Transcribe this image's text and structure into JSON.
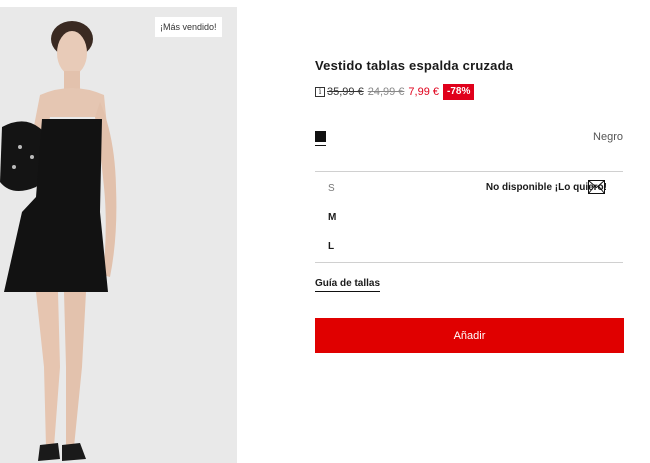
{
  "badge": "¡Más vendido!",
  "product": {
    "title": "Vestido tablas espalda cruzada",
    "info_icon": "i",
    "price_original": "35,99 €",
    "price_previous": "24,99 €",
    "price_current": "7,99 €",
    "discount": "-78%"
  },
  "color": {
    "name": "Negro",
    "swatch": "#111111"
  },
  "sizes": [
    {
      "label": "S",
      "available": false
    },
    {
      "label": "M",
      "available": true
    },
    {
      "label": "L",
      "available": true
    }
  ],
  "notify_text": "No disponible ¡Lo quiero!",
  "size_guide": "Guía de tallas",
  "add_button": "Añadir",
  "colors": {
    "accent": "#e00000",
    "discount": "#e0001b"
  }
}
